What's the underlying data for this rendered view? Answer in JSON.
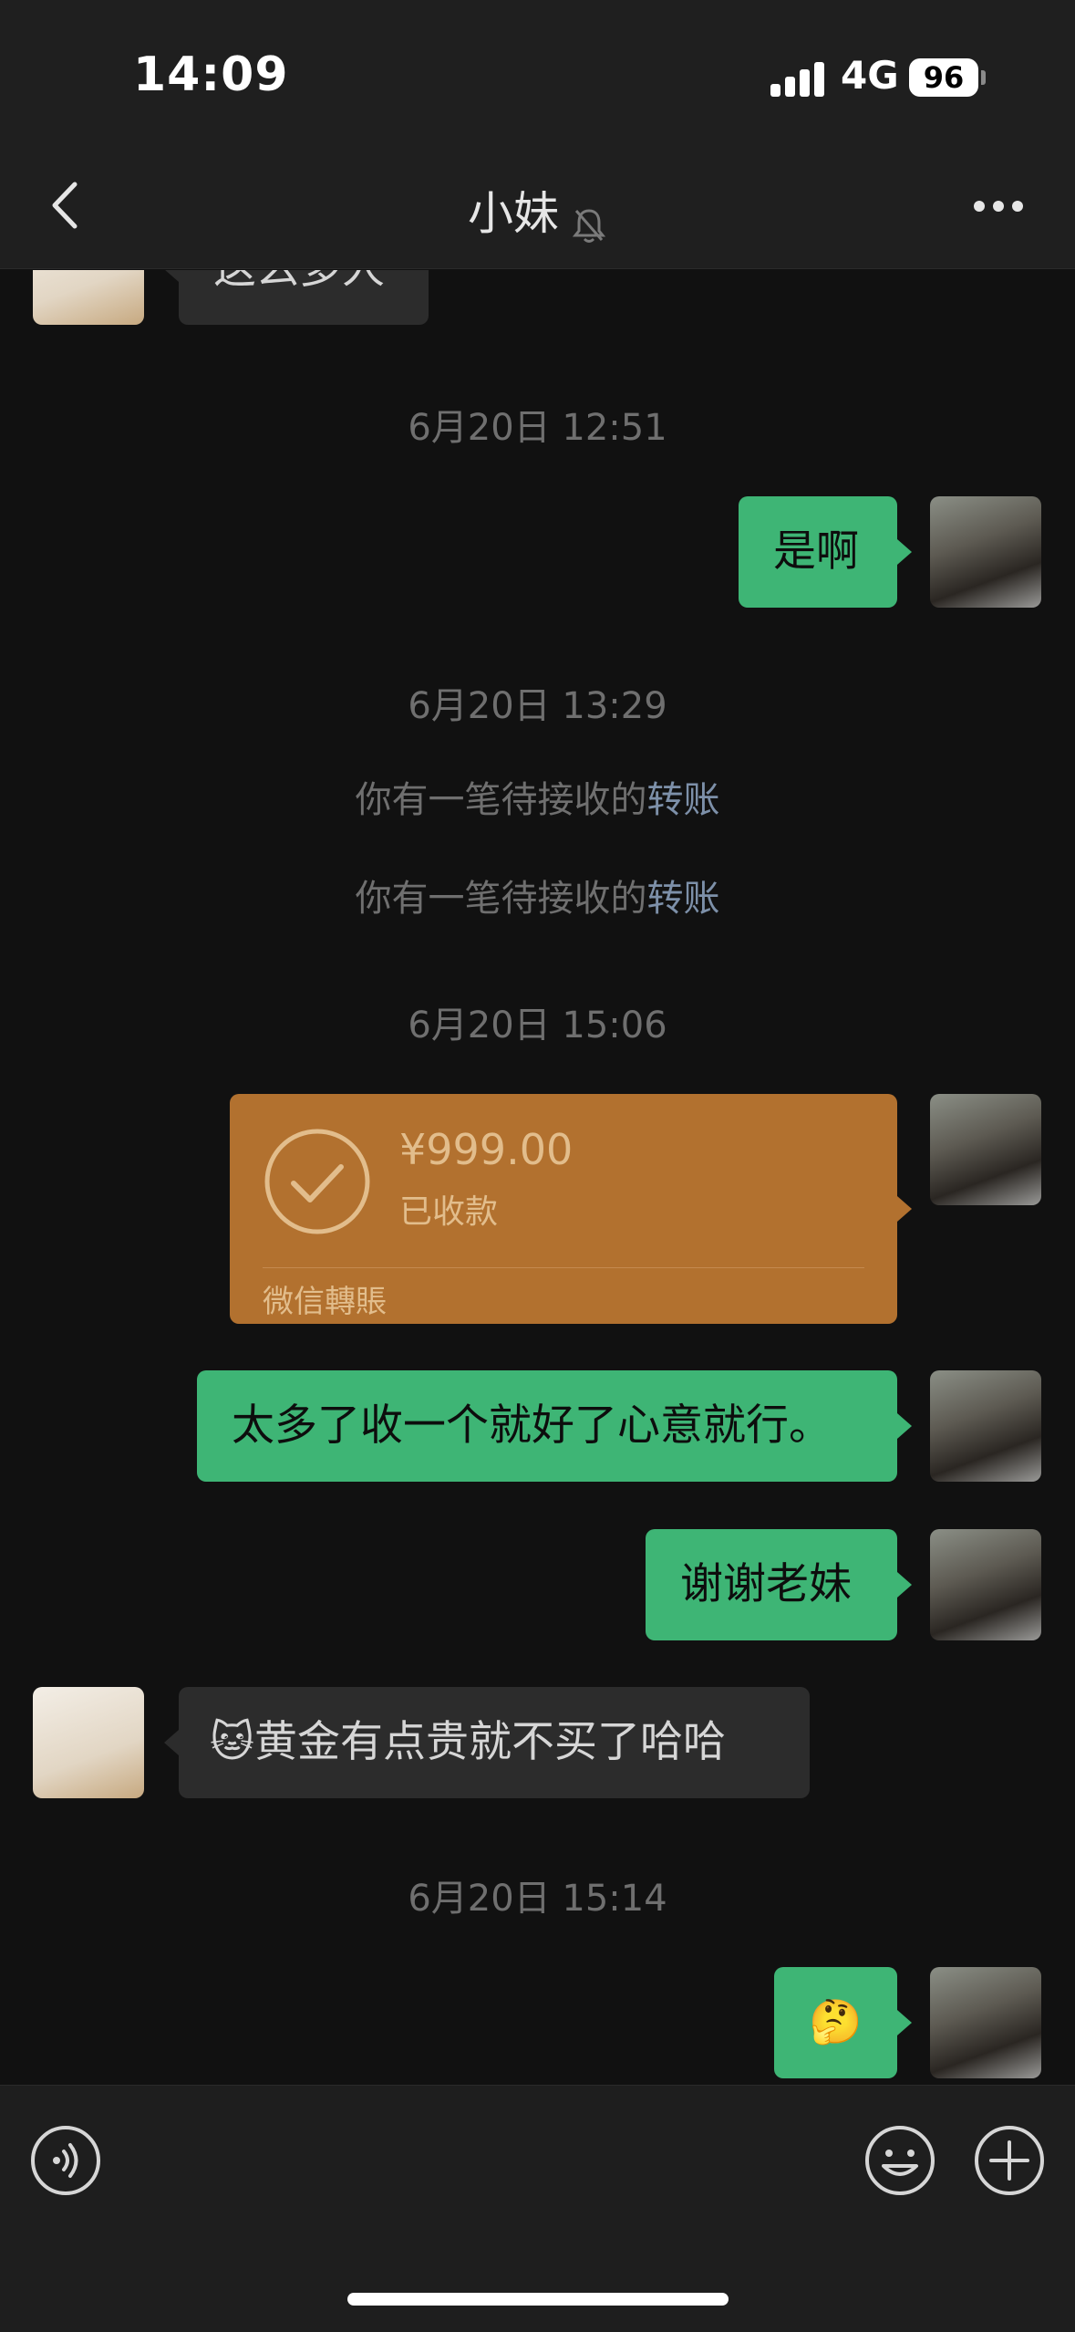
{
  "status_bar": {
    "time": "14:09",
    "network": "4G",
    "battery": "96"
  },
  "nav": {
    "title": "小妹",
    "muted": true
  },
  "messages": {
    "partial_top": {
      "text": "这么多人"
    },
    "ts1": "6月20日 12:51",
    "m1": {
      "text": "是啊"
    },
    "ts2": "6月20日 13:29",
    "sys1": {
      "text": "你有一笔待接收的",
      "link": "转账"
    },
    "sys2": {
      "text": "你有一笔待接收的",
      "link": "转账"
    },
    "ts3": "6月20日 15:06",
    "transfer": {
      "amount": "¥999.00",
      "status": "已收款",
      "footer": "微信轉賬"
    },
    "m2": {
      "text": "太多了收一个就好了心意就行。"
    },
    "m3": {
      "text": "谢谢老妹"
    },
    "m4": {
      "emoji": "🐱",
      "text": "黄金有点贵就不买了哈哈"
    },
    "ts4": "6月20日 15:14",
    "m5": {
      "emoji": "🤔"
    }
  },
  "colors": {
    "background": "#111111",
    "bar": "#1f1f1f",
    "sent_bubble": "#3eb575",
    "received_bubble": "#2c2c2c",
    "transfer_card": "#b2712f",
    "link": "#7d90a9"
  }
}
